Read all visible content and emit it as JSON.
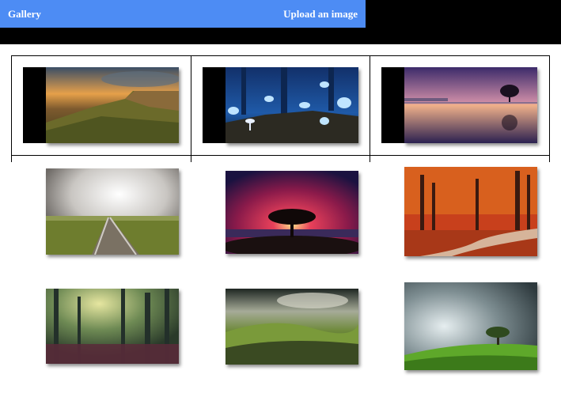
{
  "nav": {
    "title": "Gallery",
    "upload_label": "Upload an image"
  },
  "colors": {
    "nav_background": "#4d8cf4",
    "header_band": "#000000"
  },
  "gallery": {
    "images": [
      {
        "subject": "mountain plateau at sunset"
      },
      {
        "subject": "blue butterflies and mushrooms"
      },
      {
        "subject": "lone tree in purple lake"
      },
      {
        "subject": "railroad track under stormy sky"
      },
      {
        "subject": "tree silhouette under red sky"
      },
      {
        "subject": "autumn forest path"
      },
      {
        "subject": "misty green forest"
      },
      {
        "subject": "green valley with clouds"
      },
      {
        "subject": "tree on green hill under storm clouds"
      }
    ]
  }
}
